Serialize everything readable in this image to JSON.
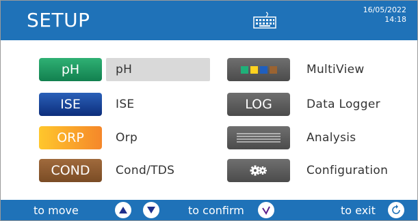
{
  "header": {
    "title": "SETUP",
    "date": "16/05/2022",
    "time": "14:18",
    "keyboard_icon": "keyboard-icon"
  },
  "menu": {
    "left": [
      {
        "button": "pH",
        "label": "pH",
        "selected": true,
        "color": "#1f9a63"
      },
      {
        "button": "ISE",
        "label": "ISE",
        "selected": false,
        "color": "#1a4aa0"
      },
      {
        "button": "ORP",
        "label": "Orp",
        "selected": false,
        "color": "#f7a42b"
      },
      {
        "button": "COND",
        "label": "Cond/TDS",
        "selected": false,
        "color": "#8e5a30"
      }
    ],
    "right": [
      {
        "button_icon": "multiview-squares-icon",
        "label": "MultiView",
        "squares": [
          "#1fb079",
          "#ffd21f",
          "#1f5fbf",
          "#9a6332"
        ]
      },
      {
        "button": "LOG",
        "label": "Data Logger"
      },
      {
        "button_icon": "lines-icon",
        "label": "Analysis"
      },
      {
        "button_icon": "gears-icon",
        "label": "Configuration"
      }
    ]
  },
  "footer": {
    "move_label": "to move",
    "confirm_label": "to confirm",
    "exit_label": "to exit",
    "accent": "#1f72b8"
  }
}
